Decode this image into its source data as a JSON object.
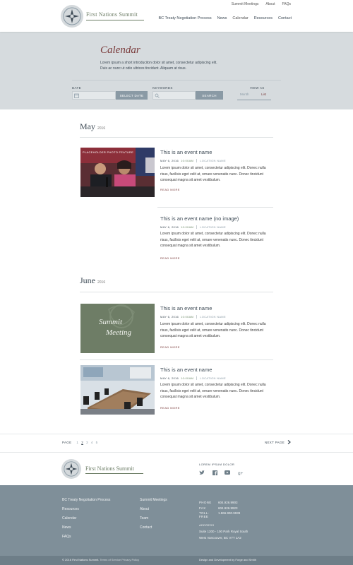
{
  "header": {
    "top_links": [
      "Summit Meetings",
      "About",
      "FAQs"
    ],
    "logo_text": "First Nations Summit",
    "nav": [
      "BC Treaty Negotiation Process",
      "News",
      "Calendar",
      "Resources",
      "Contact"
    ]
  },
  "hero": {
    "title": "Calendar",
    "intro_line1": "Lorem ipsum a short introduciton dolor sit amet, consectetur adipiscing elit.",
    "intro_line2": "Duis ac nunc ut odio ultrices tincidunt. Aliquam at risus."
  },
  "filters": {
    "date_label": "DATE",
    "select_date_button": "SELECT DATE",
    "keywords_label": "KEYWORDS",
    "search_button": "SEARCH",
    "view_as_label": "VIEW AS",
    "view_month": "Month",
    "view_list": "List"
  },
  "months": [
    {
      "name": "May",
      "year": "2016",
      "events": [
        {
          "title": "This is an event name",
          "date": "MAY 6, 2016",
          "time": "10:00AM",
          "location": "LOCATION NAME",
          "body": "Lorem ipsum dolor sit amet, consectetur adipiscing elit. Donec nulla risus, facilisis eget velit at, ornare venenatis nunc. Donec tincidunt consequat magna sit amet vestibulum.",
          "read_more": "READ MORE",
          "image_caption": "PLACEHOLDER PHOTO FEATURE"
        },
        {
          "title": "This is an event name (no image)",
          "date": "MAY 6, 2016",
          "time": "10:00AM",
          "location": "LOCATION NAME",
          "body": "Lorem ipsum dolor sit amet, consectetur adipiscing elit. Donec nulla risus, facilisis eget velit at, ornare venenatis nunc. Donec tincidunt consequat magna sit amet vestibulum.",
          "read_more": "READ MORE"
        }
      ]
    },
    {
      "name": "June",
      "year": "2016",
      "events": [
        {
          "title": "This is an event name",
          "date": "MAY 6, 2016",
          "time": "10:00AM",
          "location": "LOCATION NAME",
          "body": "Lorem ipsum dolor sit amet, consectetur adipiscing elit. Donec nulla risus, facilisis eget velit at, ornare venenatis nunc. Donec tincidunt consequat magna sit amet vestibulum.",
          "read_more": "READ MORE",
          "image_text_line1": "Summit",
          "image_text_line2": "Meeting"
        },
        {
          "title": "This is an event name",
          "date": "MAY 6, 2016",
          "time": "10:00AM",
          "location": "LOCATION NAME",
          "body": "Lorem ipsum dolor sit amet, consectetur adipiscing elit. Donec nulla risus, facilisis eget velit at, ornare venenatis nunc. Donec tincidunt consequat magna sit amet vestibulum.",
          "read_more": "READ MORE"
        }
      ]
    }
  ],
  "pagination": {
    "label": "PAGE",
    "pages": [
      "1",
      "2",
      "3",
      "4",
      "5"
    ],
    "current": "2",
    "next": "NEXT PAGE"
  },
  "footer": {
    "logo_text": "First Nations Summit",
    "social_title": "LOREM IPSUM DOLOR",
    "social_icons": [
      "twitter-icon",
      "facebook-icon",
      "youtube-icon",
      "google-plus-icon"
    ],
    "col1": [
      "BC Treaty Negotiation Process",
      "Resources",
      "Calendar",
      "News",
      "FAQs"
    ],
    "col2": [
      "Summit Meetings",
      "About",
      "Team",
      "Contact"
    ],
    "phone_label": "PHONE",
    "phone": "604.926.9903",
    "fax_label": "FAX",
    "fax": "604.926.9923",
    "tollfree_label": "TOLL-FREE",
    "tollfree": "1.866.990.9939",
    "address_label": "ADDRESS",
    "address_line1": "Suite 1200 - 100 Park Royal South",
    "address_line2": "West Vancouver, BC V7T 1A2",
    "copyright": "© 2016 First Nations Summit.",
    "terms": "Terms of Service",
    "privacy": "Privacy Policy",
    "credit": "Design and Development by Forge and Smith"
  },
  "colors": {
    "accent": "#7a3b3b",
    "green": "#6f8a6a",
    "slate": "#3d4a55",
    "hero_bg": "#d6dbde",
    "footer_bg": "#7f8f99"
  }
}
